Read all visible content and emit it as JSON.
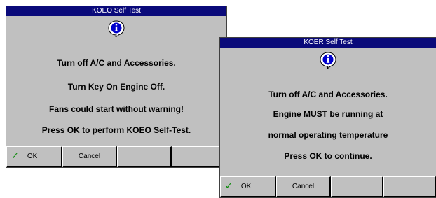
{
  "dialog1": {
    "title": "KOEO Self Test",
    "icon": "info-icon",
    "lines": [
      "Turn off A/C and Accessories.",
      "Turn Key On Engine Off.",
      "Fans could start without warning!",
      "Press OK to perform KOEO Self-Test."
    ],
    "buttons": {
      "ok": "OK",
      "cancel": "Cancel",
      "blank1": "",
      "blank2": ""
    }
  },
  "dialog2": {
    "title": "KOER Self Test",
    "icon": "info-icon",
    "lines": [
      "Turn off A/C and Accessories.",
      "Engine MUST be running at",
      "normal operating temperature",
      "Press OK to continue."
    ],
    "buttons": {
      "ok": "OK",
      "cancel": "Cancel",
      "blank1": "",
      "blank2": ""
    }
  },
  "colors": {
    "titlebar": "#0a0a7a",
    "panel": "#c0c0c0",
    "check": "#0a8a0a",
    "info_icon_fill": "#0000cc"
  }
}
